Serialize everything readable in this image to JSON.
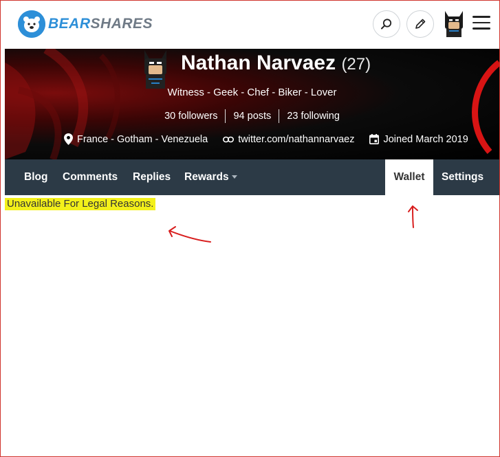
{
  "header": {
    "logo_part1": "BEAR",
    "logo_part2": "SHARES",
    "search_icon": "search-icon",
    "edit_icon": "pencil-icon",
    "menu_icon": "hamburger-icon"
  },
  "profile": {
    "name": "Nathan Narvaez",
    "reputation": "(27)",
    "about": "Witness - Geek - Chef - Biker - Lover",
    "followers": "30 followers",
    "posts": "94 posts",
    "following": "23 following",
    "location": "France - Gotham - Venezuela",
    "website": "twitter.com/nathannarvaez",
    "joined": "Joined March 2019"
  },
  "nav": {
    "blog": "Blog",
    "comments": "Comments",
    "replies": "Replies",
    "rewards": "Rewards",
    "wallet": "Wallet",
    "settings": "Settings"
  },
  "content": {
    "message": "Unavailable For Legal Reasons."
  },
  "colors": {
    "brand": "#2d8fd8",
    "nav_bg": "#2c3a46",
    "highlight": "#f3f01a",
    "annotation": "#d81e1e"
  }
}
